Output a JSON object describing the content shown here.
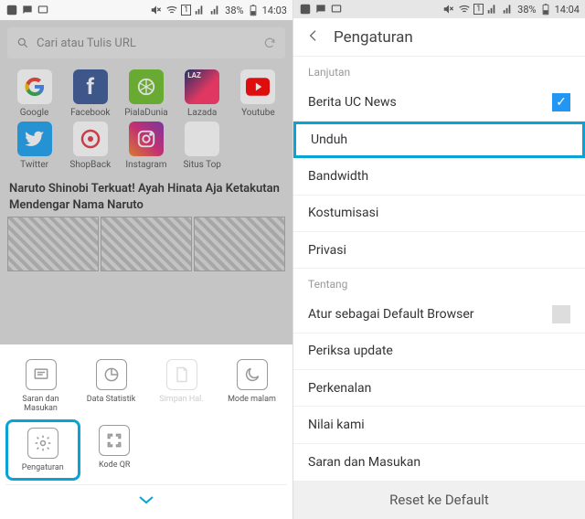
{
  "status": {
    "battery": "38%",
    "time_left": "14:03",
    "time_right": "14:04",
    "sim": "1"
  },
  "left": {
    "search_placeholder": "Cari atau Tulis URL",
    "tiles": [
      {
        "label": "Google"
      },
      {
        "label": "Facebook"
      },
      {
        "label": "PialaDunia"
      },
      {
        "label": "Lazada"
      },
      {
        "label": "Youtube"
      },
      {
        "label": "Twitter"
      },
      {
        "label": "ShopBack"
      },
      {
        "label": "Instagram"
      },
      {
        "label": "Situs Top"
      }
    ],
    "article_title": "Naruto Shinobi Terkuat! Ayah Hinata Aja Ketakutan Mendengar Nama Naruto",
    "sheet": {
      "items_row1": [
        {
          "label": "Saran dan Masukan"
        },
        {
          "label": "Data Statistik"
        },
        {
          "label": "Simpan Hal."
        },
        {
          "label": "Mode malam"
        }
      ],
      "items_row2": [
        {
          "label": "Pengaturan"
        },
        {
          "label": "Kode QR"
        }
      ]
    }
  },
  "right": {
    "title": "Pengaturan",
    "sections": {
      "advanced_label": "Lanjutan",
      "about_label": "Tentang"
    },
    "rows": {
      "news": "Berita UC News",
      "download": "Unduh",
      "bandwidth": "Bandwidth",
      "customize": "Kostumisasi",
      "privacy": "Privasi",
      "default_browser": "Atur sebagai Default Browser",
      "check_update": "Periksa update",
      "intro": "Perkenalan",
      "rate": "Nilai kami",
      "feedback": "Saran dan Masukan"
    },
    "reset": "Reset ke Default"
  }
}
